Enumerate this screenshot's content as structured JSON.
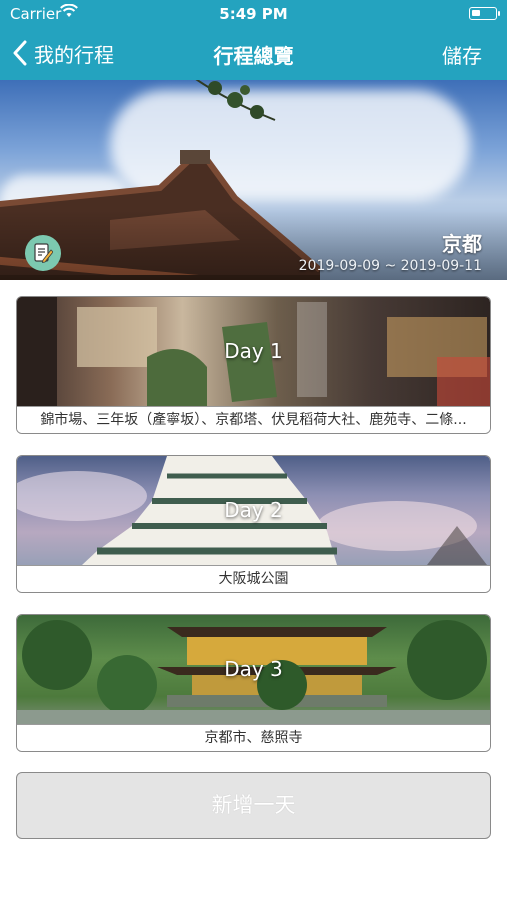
{
  "status_bar": {
    "carrier": "Carrier",
    "time": "5:49 PM",
    "wifi_icon": "wifi-icon",
    "battery_icon": "battery-icon"
  },
  "nav": {
    "back_label": "我的行程",
    "title": "行程總覽",
    "save_label": "儲存",
    "back_icon": "chevron-left-icon"
  },
  "hero": {
    "city": "京都",
    "date_range": "2019-09-09 ~ 2019-09-11",
    "edit_icon": "edit-note-icon"
  },
  "days": [
    {
      "label": "Day 1",
      "places": "錦市場、三年坂（產寧坂）、京都塔、伏見稻荷大社、鹿苑寺、二條..."
    },
    {
      "label": "Day 2",
      "places": "大阪城公園"
    },
    {
      "label": "Day 3",
      "places": "京都市、慈照寺"
    }
  ],
  "add_day_label": "新增一天",
  "colors": {
    "nav_bar": "#24a3bf",
    "edit_button": "#7cc9b0",
    "add_day_bg": "#e4e4e4"
  }
}
